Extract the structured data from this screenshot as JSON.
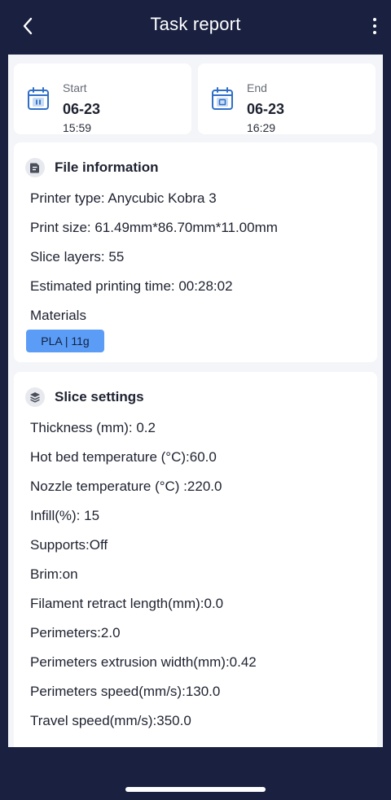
{
  "header": {
    "title": "Task report",
    "back_icon": "chevron-left-icon",
    "more_icon": "more-vertical-icon"
  },
  "times": {
    "start": {
      "label": "Start",
      "date": "06-23",
      "time": "15:59",
      "icon": "calendar-pause-icon"
    },
    "end": {
      "label": "End",
      "date": "06-23",
      "time": "16:29",
      "icon": "calendar-stop-icon"
    }
  },
  "file_info": {
    "title": "File information",
    "icon": "document-icon",
    "rows": [
      "Printer type: Anycubic Kobra 3",
      "Print size: 61.49mm*86.70mm*11.00mm",
      "Slice layers: 55",
      "Estimated printing time: 00:28:02",
      "Materials"
    ],
    "material_tag": "PLA | 11g",
    "material_color": "#5b9cf6"
  },
  "slice_settings": {
    "title": "Slice settings",
    "icon": "layers-icon",
    "rows": [
      "Thickness (mm): 0.2",
      "Hot bed temperature (°C):60.0",
      "Nozzle temperature (°C) :220.0",
      "Infill(%):  15",
      "Supports:Off",
      "Brim:on",
      "Filament retract length(mm):0.0",
      "Perimeters:2.0",
      "Perimeters extrusion width(mm):0.42",
      "Perimeters speed(mm/s):130.0",
      "Travel speed(mm/s):350.0"
    ]
  },
  "colors": {
    "background": "#1a2140",
    "accent": "#2f6fc8",
    "tag": "#5b9cf6"
  }
}
